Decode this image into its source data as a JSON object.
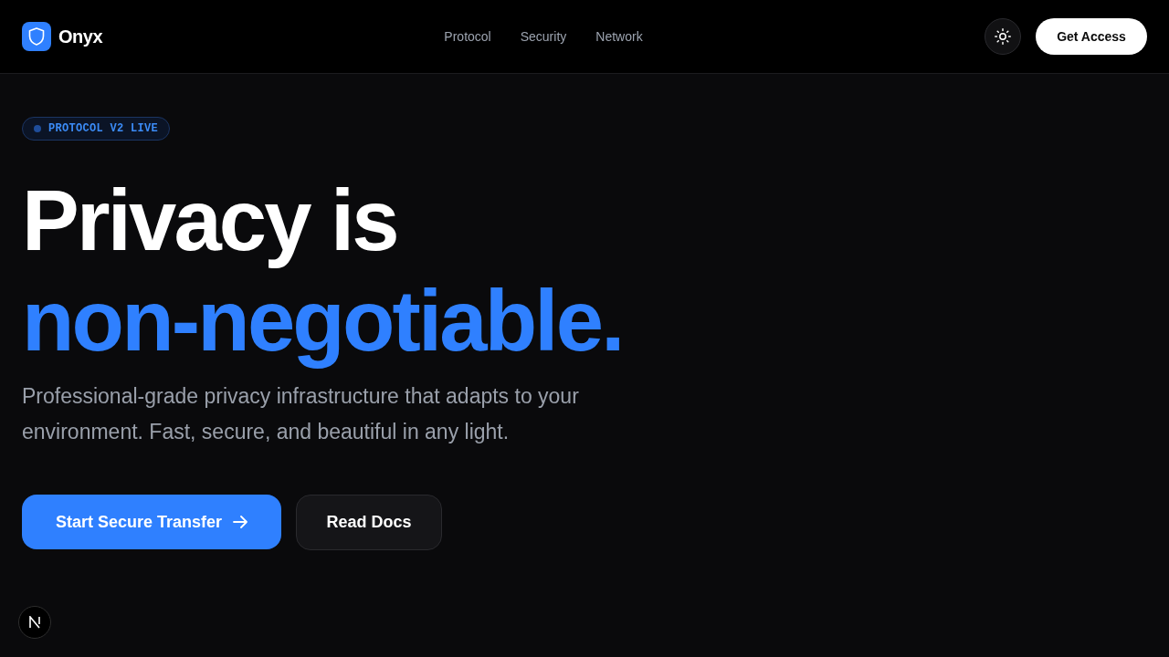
{
  "header": {
    "brand": "Onyx",
    "nav": [
      {
        "label": "Protocol"
      },
      {
        "label": "Security"
      },
      {
        "label": "Network"
      }
    ],
    "cta": "Get Access"
  },
  "hero": {
    "badge": "PROTOCOL V2 LIVE",
    "headline": [
      {
        "text": "Privacy is",
        "accent": false
      },
      {
        "text": "non-negotiable.",
        "accent": true
      }
    ],
    "description": "Professional-grade privacy infrastructure that adapts to your environment. Fast, secure, and beautiful in any light.",
    "buttons": [
      {
        "label": "Start Secure Transfer",
        "kind": "primary"
      },
      {
        "label": "Read Docs",
        "kind": "secondary"
      }
    ]
  }
}
